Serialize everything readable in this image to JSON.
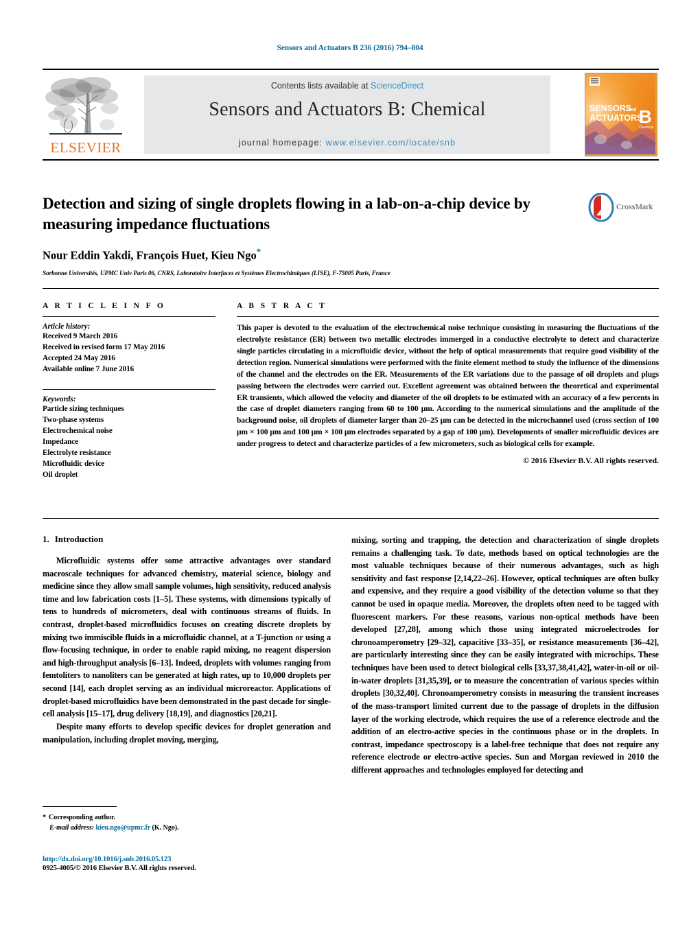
{
  "running_head": "Sensors and Actuators B 236 (2016) 794–804",
  "masthead": {
    "contents_prefix": "Contents lists available at ",
    "contents_link": "ScienceDirect",
    "journal_title": "Sensors and Actuators B: Chemical",
    "homepage_prefix": "journal homepage: ",
    "homepage_link": "www.elsevier.com/locate/snb",
    "publisher_name": "ELSEVIER",
    "cover_line1": "SENSORS",
    "cover_and": "and",
    "cover_line2": "ACTUATORS",
    "cover_letter": "B",
    "cover_sub": "Chemical"
  },
  "crossmark": {
    "label": "CrossMark"
  },
  "article": {
    "title": "Detection and sizing of single droplets flowing in a lab-on-a-chip device by measuring impedance fluctuations",
    "authors": "Nour Eddin Yakdi, François Huet, Kieu Ngo",
    "corresponding_marker": "*",
    "affiliation": "Sorbonne Universités, UPMC Univ Paris 06, CNRS, Laboratoire Interfaces et Systèmes Electrochimiques (LISE), F-75005 Paris, France"
  },
  "info": {
    "heading": "A R T I C L E    I N F O",
    "history_label": "Article history:",
    "history": [
      "Received 9 March 2016",
      "Received in revised form 17 May 2016",
      "Accepted 24 May 2016",
      "Available online 7 June 2016"
    ],
    "keywords_label": "Keywords:",
    "keywords": [
      "Particle sizing techniques",
      "Two-phase systems",
      "Electrochemical noise",
      "Impedance",
      "Electrolyte resistance",
      "Microfluidic device",
      "Oil droplet"
    ]
  },
  "abstract": {
    "heading": "A B S T R A C T",
    "text": "This paper is devoted to the evaluation of the electrochemical noise technique consisting in measuring the fluctuations of the electrolyte resistance (ER) between two metallic electrodes immerged in a conductive electrolyte to detect and characterize single particles circulating in a microfluidic device, without the help of optical measurements that require good visibility of the detection region. Numerical simulations were performed with the finite element method to study the influence of the dimensions of the channel and the electrodes on the ER. Measurements of the ER variations due to the passage of oil droplets and plugs passing between the electrodes were carried out. Excellent agreement was obtained between the theoretical and experimental ER transients, which allowed the velocity and diameter of the oil droplets to be estimated with an accuracy of a few percents in the case of droplet diameters ranging from 60 to 100 μm. According to the numerical simulations and the amplitude of the background noise, oil droplets of diameter larger than 20–25 μm can be detected in the microchannel used (cross section of 100 μm × 100 μm and 100 μm × 100 μm electrodes separated by a gap of 100 μm). Developments of smaller microfluidic devices are under progress to detect and characterize particles of a few micrometers, such as biological cells for example.",
    "copyright": "© 2016 Elsevier B.V. All rights reserved."
  },
  "introduction": {
    "number": "1.",
    "heading": "Introduction",
    "left_paragraphs": [
      "Microfluidic systems offer some attractive advantages over standard macroscale techniques for advanced chemistry, material science, biology and medicine since they allow small sample volumes, high sensitivity, reduced analysis time and low fabrication costs [1–5]. These systems, with dimensions typically of tens to hundreds of micrometers, deal with continuous streams of fluids. In contrast, droplet-based microfluidics focuses on creating discrete droplets by mixing two immiscible fluids in a microfluidic channel, at a T-junction or using a flow-focusing technique, in order to enable rapid mixing, no reagent dispersion and high-throughput analysis [6–13]. Indeed, droplets with volumes ranging from femtoliters to nanoliters can be generated at high rates, up to 10,000 droplets per second [14], each droplet serving as an individual microreactor. Applications of droplet-based microfluidics have been demonstrated in the past decade for single-cell analysis [15–17], drug delivery [18,19], and diagnostics [20,21].",
      "Despite many efforts to develop specific devices for droplet generation and manipulation, including droplet moving, merging,"
    ],
    "right_paragraphs": [
      "mixing, sorting and trapping, the detection and characterization of single droplets remains a challenging task. To date, methods based on optical technologies are the most valuable techniques because of their numerous advantages, such as high sensitivity and fast response [2,14,22–26]. However, optical techniques are often bulky and expensive, and they require a good visibility of the detection volume so that they cannot be used in opaque media. Moreover, the droplets often need to be tagged with fluorescent markers. For these reasons, various non-optical methods have been developed [27,28], among which those using integrated microelectrodes for chronoamperometry [29–32], capacitive [33–35], or resistance measurements [36–42], are particularly interesting since they can be easily integrated with microchips. These techniques have been used to detect biological cells [33,37,38,41,42], water-in-oil or oil-in-water droplets [31,35,39], or to measure the concentration of various species within droplets [30,32,40]. Chronoamperometry consists in measuring the transient increases of the mass-transport limited current due to the passage of droplets in the diffusion layer of the working electrode, which requires the use of a reference electrode and the addition of an electro-active species in the continuous phase or in the droplets. In contrast, impedance spectroscopy is a label-free technique that does not require any reference electrode or electro-active species. Sun and Morgan reviewed in 2010 the different approaches and technologies employed for detecting and"
    ]
  },
  "footnote": {
    "star": "*",
    "corresponding": "Corresponding author.",
    "email_label": "E-mail address:",
    "email": "kieu.ngo@upmc.fr",
    "email_suffix": "(K. Ngo)."
  },
  "footer": {
    "doi": "http://dx.doi.org/10.1016/j.snb.2016.05.123",
    "issn_line": "0925-4005/© 2016 Elsevier B.V. All rights reserved."
  },
  "colors": {
    "link": "#0b6a9b",
    "masthead_link": "#3a8bbd",
    "elsevier_orange": "#E9711C",
    "band_grey": "#e6e7e8"
  }
}
